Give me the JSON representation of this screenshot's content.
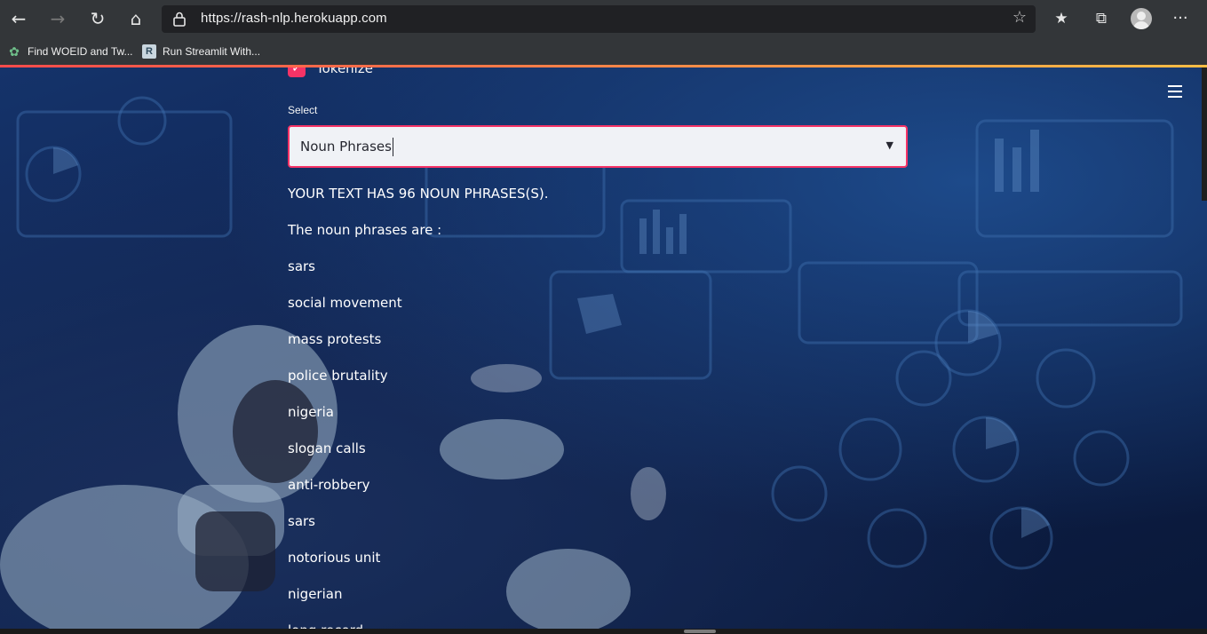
{
  "browser": {
    "url": "https://rash-nlp.herokuapp.com",
    "bookmarks": [
      {
        "label": "Find WOEID and Tw..."
      },
      {
        "label": "Run Streamlit With..."
      }
    ],
    "bookmark_icon_letter": "R",
    "icons": [
      "back-icon",
      "forward-icon",
      "reload-icon",
      "home-icon",
      "lock-icon",
      "star-icon",
      "favorites-icon",
      "collections-icon",
      "profile-icon",
      "more-icon"
    ]
  },
  "app": {
    "tokenize_label": "Tokenize",
    "select_label": "Select",
    "select_value": "Noun Phrases",
    "summary": "YOUR TEXT HAS 96 NOUN PHRASES(S).",
    "phrases_heading": "The noun phrases are :",
    "phrases": [
      "sars",
      "social movement",
      "mass protests",
      "police brutality",
      "nigeria",
      "slogan calls",
      "anti-robbery",
      "sars",
      "notorious unit",
      "nigerian",
      "long record"
    ],
    "accent_color": "#f63366",
    "menu_icon": "hamburger-icon"
  }
}
